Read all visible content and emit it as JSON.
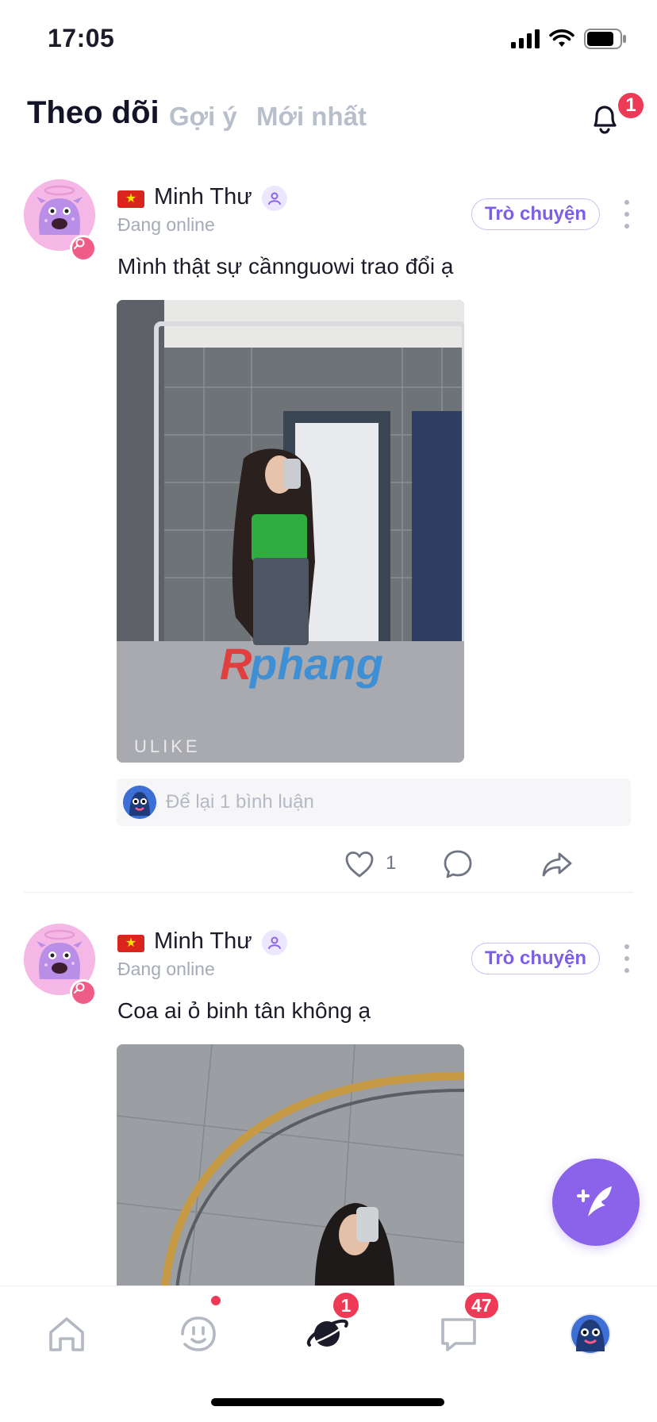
{
  "status_bar": {
    "time": "17:05"
  },
  "header": {
    "tabs": [
      {
        "label": "Theo dõi",
        "active": true
      },
      {
        "label": "Gợi ý",
        "active": false
      },
      {
        "label": "Mới nhất",
        "active": false
      }
    ],
    "notification_count": "1",
    "icons": {
      "notifications": "bell-icon"
    }
  },
  "posts": [
    {
      "username": "Minh Thư",
      "country_flag": "vietnam-flag",
      "status": "Đang online",
      "chat_label": "Trò chuyện",
      "caption": "Mình thật sự cầnnguowi trao đổi ạ",
      "image_watermark": "Rphang",
      "image_brand": "ULIKE",
      "comment_placeholder": "Để lại 1 bình luận",
      "like_count": "1"
    },
    {
      "username": "Minh Thư",
      "country_flag": "vietnam-flag",
      "status": "Đang online",
      "chat_label": "Trò chuyện",
      "caption": "Coa ai ỏ binh tân không ạ"
    }
  ],
  "bottom_nav": {
    "items": [
      {
        "name": "home",
        "icon": "home-icon"
      },
      {
        "name": "match",
        "icon": "smile-icon",
        "has_dot": true
      },
      {
        "name": "planet",
        "icon": "planet-icon",
        "badge": "1"
      },
      {
        "name": "messages",
        "icon": "chat-bubble-icon",
        "badge": "47"
      },
      {
        "name": "profile",
        "icon": "avatar-icon"
      }
    ]
  },
  "colors": {
    "accent": "#8a63ea",
    "badge": "#ee3a57",
    "muted_text": "#a4aab6",
    "chat_button_text": "#7d5ee6"
  }
}
